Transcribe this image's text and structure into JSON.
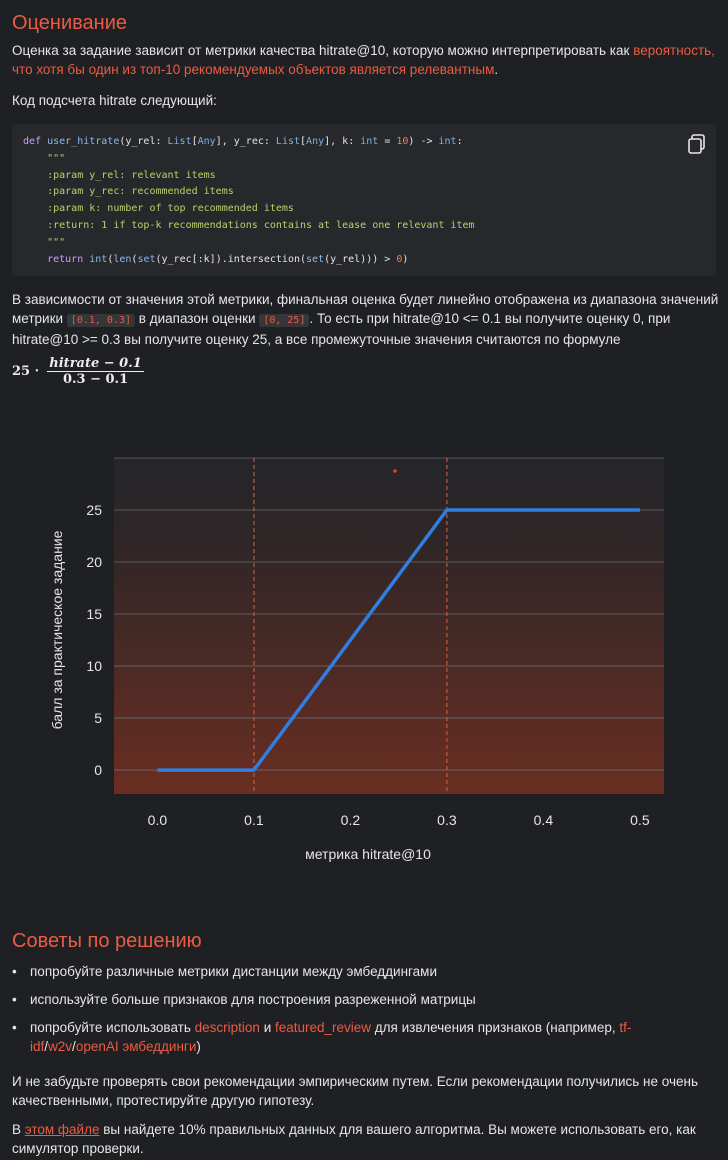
{
  "section1": {
    "title": "Оценивание",
    "intro_text": "Оценка за задание зависит от метрики качества hitrate@10, которую можно интерпретировать как",
    "intro_link": "вероятность, что хотя бы один из топ-10 рекомендуемых объектов является релевантным",
    "intro_end": ".",
    "code_heading": "Код подсчета hitrate следующий:",
    "copy_icon": "copy-icon"
  },
  "mapping": {
    "p1": "В зависимости от значения этой метрики, финальная оценка будет линейно отображена из диапазона значений метрики",
    "range_metric": "[0.1, 0.3]",
    "p2": "в диапазон оценки",
    "range_score": "[0, 25]",
    "p3": ". То есть при hitrate@10 <= 0.1 вы получите оценку 0, при hitrate@10 >= 0.3 вы получите оценку 25, а все промежуточные значения считаются по формуле"
  },
  "formula": {
    "factor": "25 ·",
    "numerator": "hitrate − 0.1",
    "denominator": "0.3 − 0.1"
  },
  "chart_data": {
    "type": "line",
    "x": [
      0.0,
      0.1,
      0.3,
      0.5
    ],
    "y": [
      0,
      0,
      25,
      25
    ],
    "xticks": [
      "0.0",
      "0.1",
      "0.2",
      "0.3",
      "0.4",
      "0.5"
    ],
    "yticks": [
      "0",
      "5",
      "10",
      "15",
      "20",
      "25"
    ],
    "xlabel": "метрика hitrate@10",
    "ylabel": "балл за практическое задание",
    "xlim": [
      -0.045,
      0.525
    ],
    "ylim": [
      -2.3,
      30
    ],
    "vlines": [
      0.1,
      0.3
    ],
    "line_color": "#2f7ee0",
    "vline_color": "#c3583f",
    "grid": true
  },
  "section2": {
    "title": "Советы по решению",
    "tip1": "попробуйте различные метрики дистанции между эмбеддингами",
    "tip2": "используйте больше признаков для построения разреженной матрицы",
    "tip3_a": "попробуйте использовать ",
    "tip3_desc": "description",
    "tip3_and": " и ",
    "tip3_fr": "featured_review",
    "tip3_b": " для извлечения признаков (например, ",
    "tip3_tfidf": "tf-idf",
    "tip3_slash1": "/",
    "tip3_w2v": "w2v",
    "tip3_slash2": "/",
    "tip3_openai": "openAI эмбеддинги",
    "tip3_end": ")",
    "note1": "И не забудьте проверять свои рекомендации эмпирическим путем. Если рекомендации получились не очень качественными, протестируйте другую гипотезу.",
    "note2_a": "В ",
    "note2_link": "этом файле",
    "note2_b": " вы найдете 10% правильных данных для вашего алгоритма. Вы можете использовать его, как симулятор проверки."
  }
}
